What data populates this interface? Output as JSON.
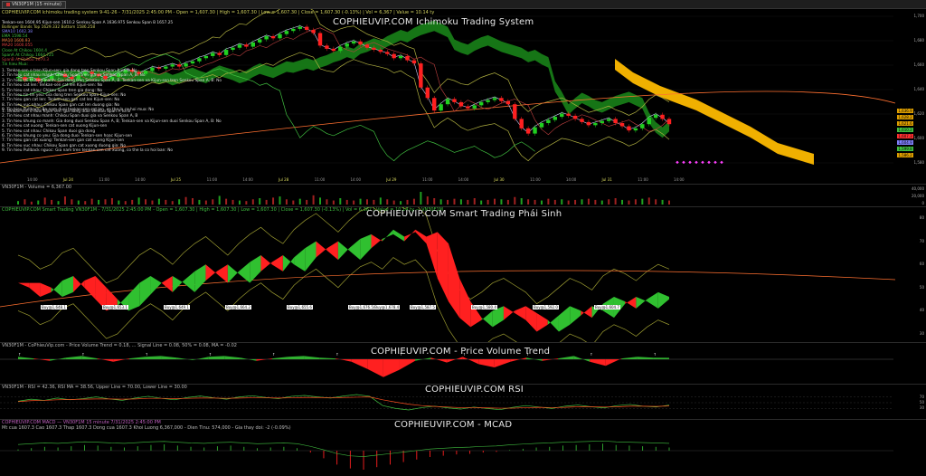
{
  "window": {
    "tab_label": "VN30F1M (15 minute)"
  },
  "main": {
    "header": "COPHIEUVIP.COM Ichimoku trading system 9-41-26 - 7/31/2025 2:45:00 PM - Open = 1,607.30 | High = 1,607.30 | Low = 1,607.30 | Close = 1,607.30 (-0.13%) | Vol = 6,367 | Value = 10.14 ty",
    "watermark": "COPHIEUVIP.COM Ichimoku Trading System",
    "legend": [
      {
        "text": "Tenkan-sen 1604.95 Kijun-sen 1610.2 Senkou Span A 1636.975 Senkou Span B 1657.25",
        "color": "#e0e0e0"
      },
      {
        "text": "Bollinger Bands Top 1629.332 Bottom 1586.258",
        "color": "#c8c860"
      },
      {
        "text": "SMA10 1602.38",
        "color": "#8080ff"
      },
      {
        "text": "EMA 1598.54",
        "color": "#40c040"
      },
      {
        "text": "MA10 1600.93",
        "color": "#ff8040"
      },
      {
        "text": "MA20 1600.055",
        "color": "#e04040"
      },
      {
        "text": "Close At Chikou 1604.4",
        "color": "#40c040"
      },
      {
        "text": "SpanA At Chikou 1664.725",
        "color": "#40c040"
      },
      {
        "text": "SpanB At Chikou 1670.3",
        "color": "#c04040"
      },
      {
        "text": "Tin hieu Mua:",
        "color": "#40c040"
      }
    ],
    "signals_buy": [
      "1. Tenkan-sen o tren Kijun-sen: gia dang tren Senkou Span A va B: No",
      "2. Tin hieu cat nhau manh: Chikou Span tren gia va Senkou Span A, B: No",
      "3. Tin hieu thi truong manh: Gia dong tren Senkou Span A, B. Tenkan-sen va Kijun-sen tren Senkou Span A, B: No",
      "4. Tin hieu cat len: Tenkan-sen cat len Kijun-sen: No",
      "5. Tin hieu cat nhau: Chikou Span tren gia dong: No",
      "6. Tin hieu tin tin yeu: Gia dong tren Senkou Span Kijun-sen: No",
      "7. Tin hieu gan cat len: Tenkan-sen gan cat len Kijun-sen: No",
      "8. Tin hieu vuc nhau: Chikou Span gan cat len duong gia: No",
      "9. Tin hieu Pullback: Ba nam duoi tenkan-sen cat len, co the la co hoi mua: No"
    ],
    "signals_sell": [
      "1. Tenkan-sen o duoi Kijun-sen: gia dang duoi Senkou Span A va B",
      "2. Tin hieu cat nhau manh: Chikou Span duoi gia va Senkou Span A, B",
      "3. Tin hieu khung co manh: Gia dong duoi Senkou Span A, B; Tenkan-sen va Kijun-sen duoi Senkou Span A, B: No",
      "4. Tin hieu cat xuong: Tenkan-sen cat xuong Kijun-sen",
      "5. Tin hieu cat nhau: Chikou Span duoi gia dong",
      "6. Tin hieu khung co yeu: Gia dong duoi Tenkan-sen hoac Kijun-sen",
      "7. Tin hieu gan cat xuong: Tenkan-sen gan cat xuong Kijun-sen",
      "8. Tin hieu vuc nhau: Chikou Span gan cat xuong duong gia: No",
      "9. Tin hieu Pullback nguoc: Gia nam tren tenkan-sen cat xuong, co the la co hoi ban: No"
    ],
    "y_labels": [
      "1,700",
      "1,680",
      "1,660",
      "1,640",
      "1,620",
      "1,600",
      "1,580"
    ],
    "price_boxes": [
      {
        "text": "1,636.9",
        "color": "#e0a000"
      },
      {
        "text": "1,628.2",
        "color": "#e0a000"
      },
      {
        "text": "1,621.6",
        "color": "#e0a000"
      },
      {
        "text": "1,610.2",
        "color": "#40c040"
      },
      {
        "text": "1,607.3",
        "color": "#ff3030"
      },
      {
        "text": "1,604.9",
        "color": "#8080ff"
      },
      {
        "text": "1,599.8",
        "color": "#40c040"
      },
      {
        "text": "1,586.2",
        "color": "#e0a000"
      }
    ],
    "x_labels": [
      "14:00",
      "Jul 24",
      "11:00",
      "14:00",
      "Jul 25",
      "11:00",
      "14:00",
      "Jul 28",
      "11:00",
      "14:00",
      "Jul 29",
      "11:00",
      "14:00",
      "Jul 30",
      "11:00",
      "14:00",
      "Jul 31",
      "11:00",
      "14:00"
    ]
  },
  "volume": {
    "header": "VN30F1M - Volume = 6,367.00",
    "y_labels": [
      "40,000",
      "20,000",
      "0"
    ]
  },
  "smart": {
    "header": "COPHIEUVIP.COM Smart Trading VN30F1M - 7/31/2025 2:45:00 PM - Open = 1,607.30 | High = 1,607.30 | Low = 1,607.30 | Close = 1,607.30 (-0.13%) | Vol = 6,367 | Value = 10.14 ty — VN30F1M",
    "watermark": "COPHIEUVIP.COM Smart Trading Phái Sinh",
    "y_labels": [
      "80",
      "70",
      "60",
      "50",
      "40",
      "30"
    ],
    "buy_labels": [
      "Buy@1,648.1",
      "Buy@1,653.1",
      "Buy@1,649.1",
      "Buy@1,664.2",
      "Buy@1,655.6",
      "Buy@1,676.5/Buy@1,678.4",
      "Buy@1,587.5",
      "Buy@1,580.4",
      "Buy@1,592.0",
      "Buy@1,604.7"
    ]
  },
  "pvt": {
    "header": "VN30F1M - CoPhieuVip.com - Price Volume Trend = 0.18, ... Signal Line = 0.08, 50% = 0.08, MA = -0.02",
    "watermark": "COPHIEUVIP.COM - Price Volume Trend"
  },
  "rsi": {
    "header": "VN30F1M - RSI = 42.36, RSI MA = 38.56, Upper Line = 70.00, Lower Line = 30.00",
    "watermark": "COPHIEUVIP.COM RSI",
    "y_labels": [
      "70",
      "50",
      "30"
    ]
  },
  "macd": {
    "header": "COPHIEUVIP.COM MACD — VN30F1M   15 minute   7/31/2025 2:45:00 PM",
    "header2": "Mt cua 1607.3  Cao 1607.3  Thap 1607.3  Dong cua 1607.3  Khoi Luong 6,367,000 - Dien Tinu: 574,000 - Gia thay doi: -2 (-0.09%)",
    "watermark": "COPHIEUVIP.COM - MCAD"
  },
  "chart_data": [
    {
      "type": "candlestick",
      "title": "COPHIEUVIP.COM Ichimoku Trading System",
      "ylim": [
        1570,
        1710
      ],
      "close": [
        1652,
        1649,
        1651,
        1648,
        1650,
        1653,
        1655,
        1652,
        1650,
        1654,
        1657,
        1655,
        1653,
        1650,
        1652,
        1656,
        1659,
        1657,
        1655,
        1658,
        1661,
        1660,
        1662,
        1664,
        1662,
        1665,
        1667,
        1670,
        1672,
        1675,
        1673,
        1678,
        1680,
        1683,
        1681,
        1685,
        1688,
        1691,
        1689,
        1693,
        1696,
        1698,
        1700,
        1697,
        1694,
        1682,
        1679,
        1677,
        1681,
        1684,
        1686,
        1683,
        1680,
        1678,
        1676,
        1674,
        1670,
        1672,
        1668,
        1665,
        1642,
        1632,
        1620,
        1626,
        1631,
        1628,
        1624,
        1622,
        1625,
        1628,
        1630,
        1632,
        1629,
        1626,
        1612,
        1603,
        1598,
        1604,
        1608,
        1611,
        1614,
        1617,
        1615,
        1612,
        1609,
        1606,
        1608,
        1610,
        1612,
        1608,
        1605,
        1601,
        1603,
        1607,
        1613,
        1616,
        1612,
        1607
      ],
      "bb_top": 1629.332,
      "bb_bottom": 1586.258,
      "senkou_a_end": 1636.975,
      "senkou_b_end": 1657.25
    },
    {
      "type": "bar",
      "title": "Volume",
      "values": [
        6,
        9,
        5,
        7,
        12,
        8,
        6,
        14,
        9,
        7,
        6,
        10,
        8,
        9,
        11,
        7,
        6,
        8,
        12,
        9,
        7,
        10,
        8,
        6,
        9,
        13,
        11,
        8,
        7,
        9,
        15,
        10,
        8,
        7,
        6,
        9,
        11,
        8,
        12,
        14,
        9,
        7,
        10,
        8,
        16,
        12,
        9,
        7,
        11,
        8,
        7,
        10,
        9,
        8,
        12,
        9,
        7,
        6,
        8,
        10,
        22,
        14,
        11,
        9,
        8,
        10,
        9,
        8,
        11,
        7,
        8,
        10,
        9,
        8,
        13,
        11,
        9,
        8,
        7,
        10,
        8,
        9,
        7,
        8,
        9,
        10,
        8,
        7,
        9,
        11,
        8,
        7,
        9,
        10,
        12,
        9,
        8,
        7
      ]
    },
    {
      "type": "area",
      "title": "COPHIEUVIP.COM Smart Trading Phái Sinh",
      "ylim": [
        30,
        80
      ],
      "values": [
        52,
        50,
        46,
        48,
        53,
        55,
        50,
        45,
        40,
        42,
        47,
        52,
        55,
        52,
        48,
        53,
        57,
        60,
        56,
        52,
        57,
        61,
        64,
        60,
        57,
        63,
        67,
        70,
        66,
        62,
        67,
        71,
        73,
        70,
        75,
        72,
        74,
        69,
        54,
        44,
        37,
        33,
        36,
        40,
        42,
        39,
        36,
        31,
        34,
        38,
        42,
        40,
        37,
        43,
        46,
        44,
        41,
        45,
        48,
        46
      ]
    },
    {
      "type": "area",
      "title": "COPHIEUVIP.COM - Price Volume Trend",
      "values": [
        0.3,
        0.1,
        -0.2,
        0.2,
        0.4,
        0.1,
        -0.3,
        0.1,
        0.3,
        0.4,
        0.2,
        -0.1,
        0.3,
        0.4,
        0.2,
        -0.2,
        0.1,
        0.3,
        0.4,
        0.2,
        0.1,
        -0.3,
        -1.2,
        -2.2,
        -1.3,
        -0.2,
        0.2,
        -0.4,
        0.3,
        -0.6,
        -1.0,
        -0.3,
        0.2,
        -0.2,
        0.1,
        0.4,
        -0.3,
        -0.8,
        0.1,
        0.3,
        0.2,
        0.18
      ]
    },
    {
      "type": "line",
      "title": "COPHIEUVIP.COM RSI",
      "ylim": [
        0,
        100
      ],
      "series": [
        {
          "name": "RSI",
          "values": [
            55,
            62,
            58,
            66,
            60,
            64,
            70,
            63,
            58,
            66,
            72,
            65,
            60,
            68,
            73,
            67,
            62,
            70,
            74,
            68,
            64,
            72,
            75,
            70,
            66,
            73,
            78,
            72,
            40,
            30,
            25,
            33,
            38,
            32,
            28,
            35,
            30,
            26,
            34,
            40,
            35,
            30,
            38,
            42,
            36,
            32,
            40,
            44,
            38,
            35,
            42
          ]
        },
        {
          "name": "RSI MA",
          "values": [
            54,
            57,
            58,
            60,
            61,
            62,
            63,
            63,
            62,
            63,
            65,
            65,
            64,
            65,
            66,
            66,
            65,
            66,
            67,
            67,
            66,
            67,
            68,
            68,
            67,
            68,
            69,
            70,
            60,
            52,
            45,
            40,
            37,
            35,
            33,
            33,
            32,
            31,
            31,
            33,
            34,
            33,
            34,
            36,
            36,
            35,
            36,
            38,
            38,
            37,
            38.56
          ]
        }
      ]
    },
    {
      "type": "bar",
      "title": "COPHIEUVIP.COM - MCAD",
      "values": [
        0.2,
        0.4,
        0.6,
        0.5,
        0.7,
        0.9,
        0.8,
        0.6,
        0.5,
        0.7,
        0.9,
        1.0,
        0.8,
        0.6,
        0.5,
        0.7,
        0.8,
        0.6,
        0.4,
        0.5,
        0.6,
        0.4,
        -0.3,
        -1.2,
        -2.2,
        -2.8,
        -3.0,
        -2.6,
        -2.2,
        -1.8,
        -1.4,
        -1.0,
        -0.8,
        -0.6,
        -0.5,
        -0.3,
        -0.2,
        0.1,
        0.3,
        0.5,
        0.6,
        0.8,
        0.9,
        1.0,
        1.1,
        0.9,
        0.8,
        0.7,
        0.6,
        0.5
      ]
    }
  ]
}
